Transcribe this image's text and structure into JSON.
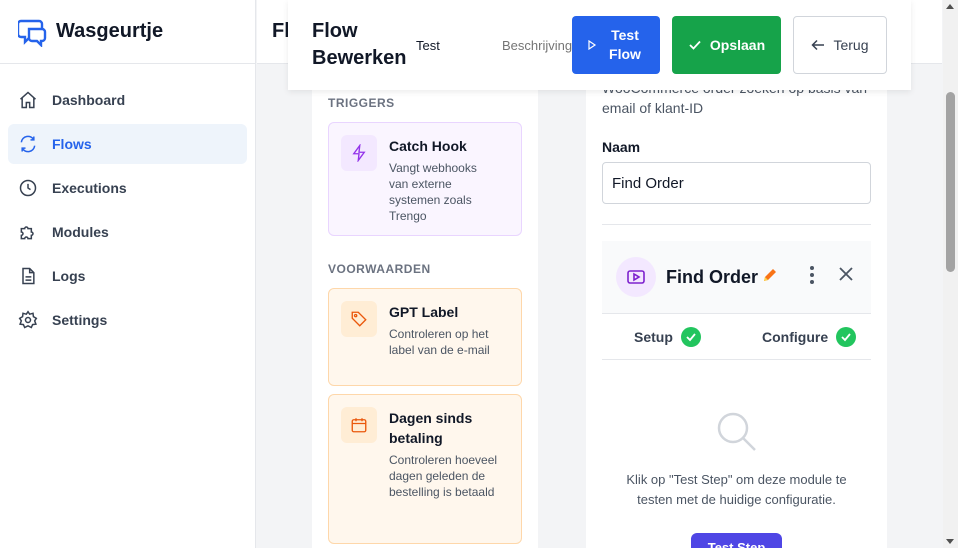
{
  "brand": {
    "name": "Wasgeurtje"
  },
  "sidebar": {
    "items": [
      {
        "label": "Dashboard",
        "icon": "home-icon"
      },
      {
        "label": "Flows",
        "icon": "refresh-icon",
        "active": true
      },
      {
        "label": "Executions",
        "icon": "clock-icon"
      },
      {
        "label": "Modules",
        "icon": "puzzle-icon"
      },
      {
        "label": "Logs",
        "icon": "document-icon"
      },
      {
        "label": "Settings",
        "icon": "gear-icon"
      }
    ]
  },
  "page": {
    "title": "Fl"
  },
  "editor": {
    "title": "Flow Bewerken",
    "name_value": "Test",
    "description_placeholder": "Beschrijving",
    "test_button": "Test Flow",
    "save_button": "Opslaan",
    "back_button": "Terug"
  },
  "palette": {
    "triggers_title": "TRIGGERS",
    "conditions_title": "VOORWAARDEN",
    "triggers": [
      {
        "title": "Catch Hook",
        "description": "Vangt webhooks van externe systemen zoals Trengo",
        "icon": "bolt-icon"
      }
    ],
    "conditions": [
      {
        "title": "GPT Label",
        "description": "Controleren op het label van de e-mail",
        "icon": "tag-icon"
      },
      {
        "title": "Dagen sinds betaling",
        "description": "Controleren hoeveel dagen geleden de bestelling is betaald",
        "icon": "calendar-icon"
      }
    ]
  },
  "config": {
    "description": "WooCommerce order zoeken op basis van email of klant-ID",
    "name_label": "Naam",
    "name_value": "Find Order",
    "step": {
      "title": "Find Order",
      "icon": "play-icon",
      "tabs": [
        {
          "label": "Setup",
          "status": "complete"
        },
        {
          "label": "Configure",
          "status": "complete"
        }
      ]
    },
    "empty_text": "Klik op \"Test Step\" om deze module te testen met de huidige configuratie.",
    "run_button": "Test Step"
  },
  "colors": {
    "primary": "#2563eb",
    "success": "#16a34a",
    "trigger_bg": "#faf5ff",
    "condition_bg": "#fff7ed",
    "accent_purple": "#4f46e5"
  }
}
